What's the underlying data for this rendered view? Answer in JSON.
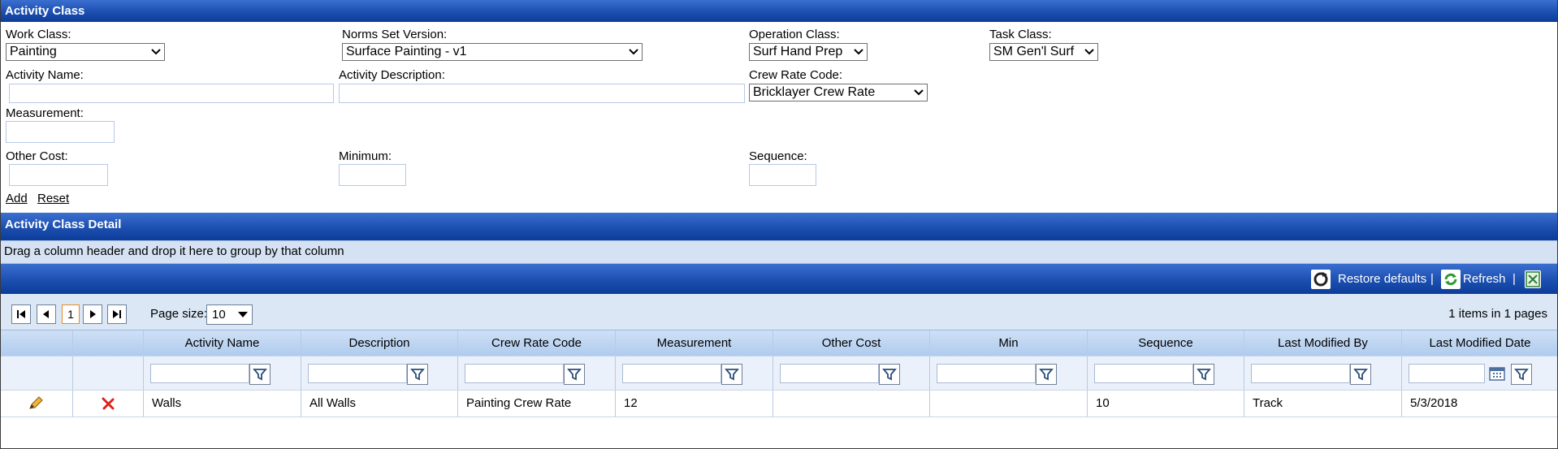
{
  "activity_class": {
    "title": "Activity Class",
    "work_class": {
      "label": "Work Class:",
      "value": "Painting"
    },
    "norms_set_version": {
      "label": "Norms Set Version:",
      "value": "Surface Painting - v1"
    },
    "operation_class": {
      "label": "Operation Class:",
      "value": "Surf Hand Prep"
    },
    "task_class": {
      "label": "Task Class:",
      "value": "SM Gen'l Surf"
    },
    "activity_name": {
      "label": "Activity Name:",
      "value": ""
    },
    "activity_description": {
      "label": "Activity Description:",
      "value": ""
    },
    "crew_rate_code": {
      "label": "Crew Rate Code:",
      "value": "Bricklayer Crew Rate"
    },
    "measurement": {
      "label": "Measurement:",
      "value": ""
    },
    "other_cost": {
      "label": "Other Cost:",
      "value": ""
    },
    "minimum": {
      "label": "Minimum:",
      "value": ""
    },
    "sequence": {
      "label": "Sequence:",
      "value": ""
    },
    "add_label": "Add",
    "reset_label": "Reset"
  },
  "detail": {
    "title": "Activity Class Detail",
    "group_hint": "Drag a column header and drop it here to group by that column",
    "toolbar": {
      "restore_label": "Restore defaults",
      "refresh_label": "Refresh",
      "separator": "|"
    },
    "pager": {
      "current_page": "1",
      "page_size_label": "Page size:",
      "page_size": "10",
      "summary": "1 items in 1 pages"
    },
    "columns": [
      "Activity Name",
      "Description",
      "Crew Rate Code",
      "Measurement",
      "Other Cost",
      "Min",
      "Sequence",
      "Last Modified By",
      "Last Modified Date"
    ],
    "rows": [
      {
        "activity_name": "Walls",
        "description": "All Walls",
        "crew_rate_code": "Painting Crew Rate",
        "measurement": "12",
        "other_cost": "",
        "min": "",
        "sequence": "10",
        "last_modified_by": "Track",
        "last_modified_date": "5/3/2018"
      }
    ]
  },
  "icons": {
    "edit": "pencil-icon",
    "delete": "red-x-icon",
    "filter": "funnel-icon",
    "calendar": "calendar-icon",
    "restore": "restore-icon",
    "refresh": "refresh-icon",
    "export": "excel-icon"
  }
}
